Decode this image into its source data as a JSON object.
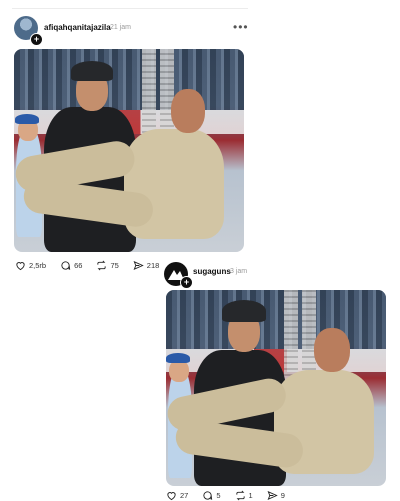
{
  "post1": {
    "username": "afiqahqanitajazila",
    "time": "21 jam",
    "stats": {
      "likes": "2,5rb",
      "comments": "66",
      "reposts": "75",
      "shares": "218"
    }
  },
  "post2": {
    "username": "sugaguns",
    "time": "3 jam",
    "stats": {
      "likes": "27",
      "comments": "5",
      "reposts": "1",
      "shares": "9"
    }
  },
  "icons": {
    "more": "more-icon",
    "like": "heart-icon",
    "comment": "comment-icon",
    "repost": "repost-icon",
    "share": "share-icon",
    "follow": "plus-icon"
  },
  "colors": {
    "text": "#111111",
    "muted": "#9a9a9a",
    "background": "#ffffff"
  }
}
